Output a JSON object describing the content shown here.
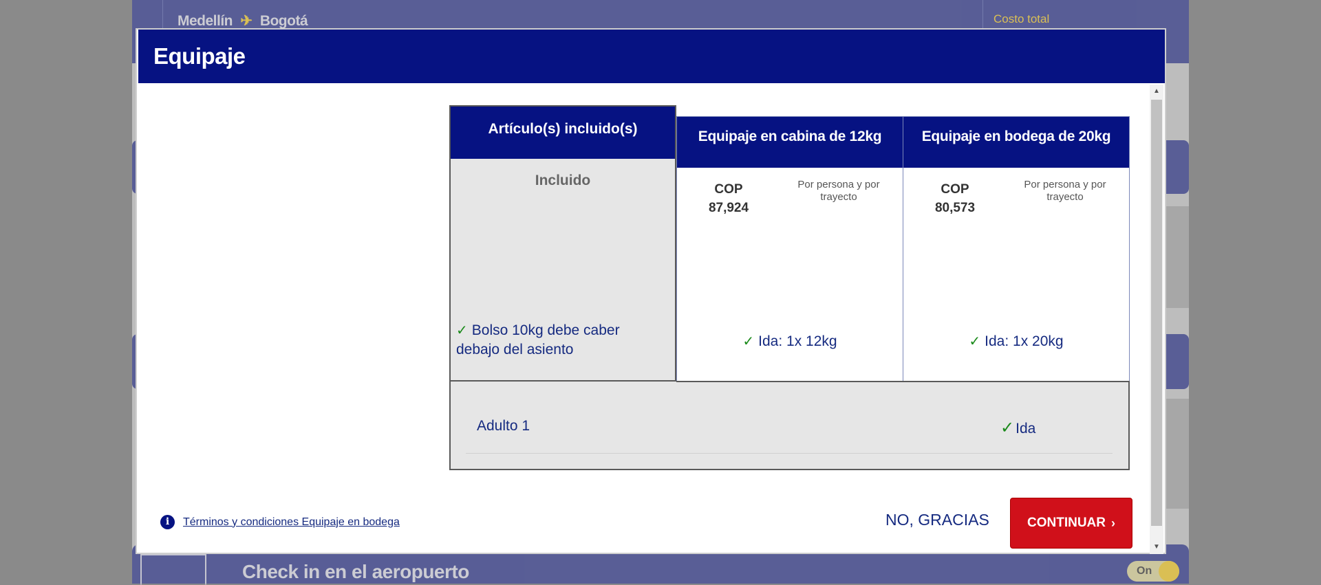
{
  "background": {
    "origin": "Medellín",
    "destination": "Bogotá",
    "cost_label": "Costo total",
    "footer_title": "Check in en el aeropuerto",
    "toggle_label": "On"
  },
  "modal": {
    "title": "Equipaje",
    "included": {
      "header": "Artículo(s) incluido(s)",
      "sub": "Incluido",
      "item": "Bolso 10kg debe caber debajo del asiento"
    },
    "options": [
      {
        "header": "Equipaje en cabina de 12kg",
        "currency": "COP",
        "price": "87,924",
        "per": "Por persona y por trayecto",
        "feature": "Ida: 1x 12kg"
      },
      {
        "header": "Equipaje en bodega de 20kg",
        "currency": "COP",
        "price": "80,573",
        "per": "Por persona y por trayecto",
        "feature": "Ida: 1x 20kg"
      }
    ],
    "passenger": {
      "name": "Adulto 1",
      "status": "Ida"
    },
    "terms_link": "Términos y condiciones Equipaje en bodega",
    "no_thanks": "NO, GRACIAS",
    "continue": "CONTINUAR"
  },
  "colors": {
    "brand_blue": "#061282",
    "accent_yellow": "#f2c200",
    "cta_red": "#d0101a",
    "check_green": "#1a8a1a"
  },
  "icons": {
    "plane": "airplane-icon",
    "check": "checkmark-icon",
    "info": "info-icon",
    "chevron": "chevron-right-icon"
  }
}
